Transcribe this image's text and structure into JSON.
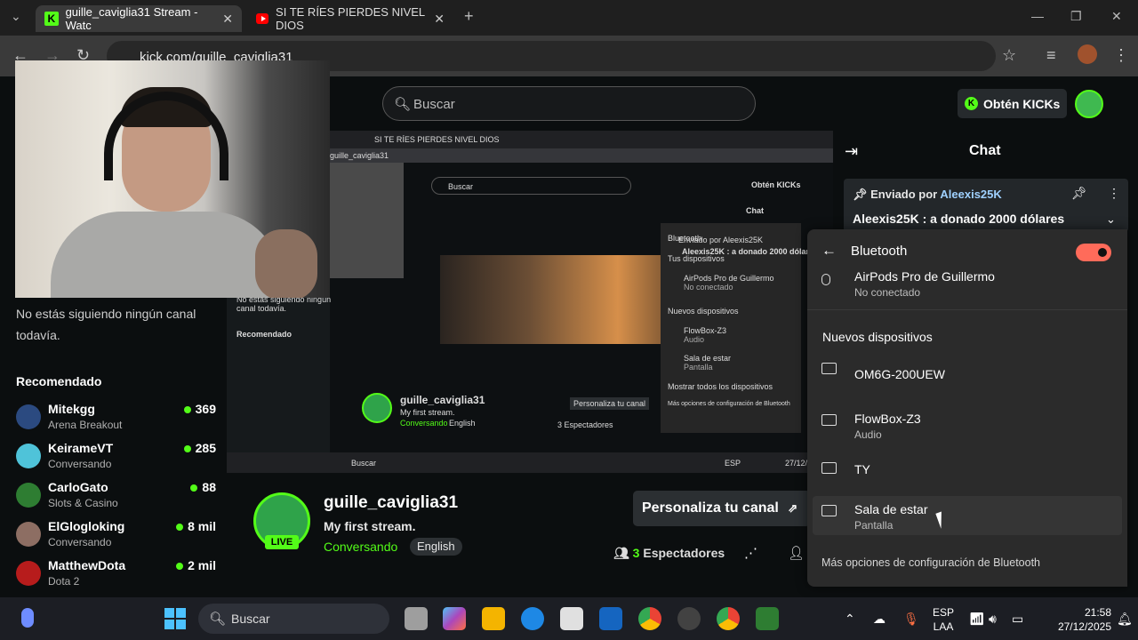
{
  "browser": {
    "tabs": [
      {
        "label": "guille_caviglia31 Stream - Watc"
      },
      {
        "label": "SI TE RÍES PIERDES NIVEL DIOS"
      }
    ],
    "url": "kick.com/guille_caviglia31"
  },
  "header": {
    "search_placeholder": "Buscar",
    "kicks_label": "Obtén KICKs"
  },
  "sidebar": {
    "not_following": "No estás siguiendo ningún canal todavía.",
    "recommended_title": "Recomendado",
    "items": [
      {
        "name": "Mitekgg",
        "category": "Arena Breakout",
        "viewers": "369",
        "color": "#2b4a80"
      },
      {
        "name": "KeirameVT",
        "category": "Conversando",
        "viewers": "285",
        "color": "#4fc3d9"
      },
      {
        "name": "CarloGato",
        "category": "Slots & Casino",
        "viewers": "88",
        "color": "#2e7d32"
      },
      {
        "name": "ElGlogloking",
        "category": "Conversando",
        "viewers": "8 mil",
        "color": "#8d6e63"
      },
      {
        "name": "MatthewDota",
        "category": "Dota 2",
        "viewers": "2 mil",
        "color": "#b71c1c"
      }
    ]
  },
  "chat": {
    "title": "Chat",
    "pinned_prefix": "Enviado por",
    "pinned_by": "Aleexis25K",
    "pinned_message": "Aleexis25K : a donado 2000 dólares"
  },
  "channel": {
    "name": "guille_caviglia31",
    "stream_title": "My first stream.",
    "category": "Conversando",
    "language": "English",
    "live": "LIVE",
    "customize": "Personaliza tu canal",
    "viewers_count": "3",
    "viewers_label": "Espectadores"
  },
  "bluetooth": {
    "title": "Bluetooth",
    "paired": {
      "name": "AirPods Pro de Guillermo",
      "status": "No conectado"
    },
    "new_devices_title": "Nuevos dispositivos",
    "devices": [
      {
        "name": "OM6G-200UEW",
        "sub": ""
      },
      {
        "name": "FlowBox-Z3",
        "sub": "Audio"
      },
      {
        "name": "TY",
        "sub": ""
      },
      {
        "name": "Sala de estar",
        "sub": "Pantalla"
      }
    ],
    "more": "Más opciones de configuración de Bluetooth"
  },
  "taskbar": {
    "search": "Buscar",
    "lang_top": "ESP",
    "lang_bottom": "LAA",
    "time": "21:58",
    "date": "27/12/2025"
  },
  "nested": {
    "tab": "SI TE RÍES PIERDES NIVEL DIOS",
    "search": "Buscar",
    "kicks": "Obtén KICKs",
    "chat": "Chat",
    "url": "guille_caviglia31",
    "pinned": "Enviado por Aleexis25K",
    "pinned_msg": "Aleexis25K : a donado 2000 dólares",
    "bt_title": "Bluetooth",
    "bt_your": "Tus dispositivos",
    "bt_airpods": "AirPods Pro de Guillermo",
    "bt_nc": "No conectado",
    "bt_new": "Nuevos dispositivos",
    "bt_flow": "FlowBox-Z3",
    "bt_audio": "Audio",
    "bt_sala": "Sala de estar",
    "bt_pantalla": "Pantalla",
    "bt_show_all": "Mostrar todos los dispositivos",
    "bt_more": "Más opciones de configuración de Bluetooth",
    "not_following": "No estás siguiendo ningún canal todavía.",
    "recommended": "Recomendado",
    "channel": "guille_caviglia31",
    "stream_title": "My first stream.",
    "category": "Conversando",
    "language": "English",
    "customize": "Personaliza tu canal",
    "viewers": "3 Espectadores",
    "tb_search": "Buscar",
    "time": "27/12/2",
    "lang": "ESP"
  }
}
